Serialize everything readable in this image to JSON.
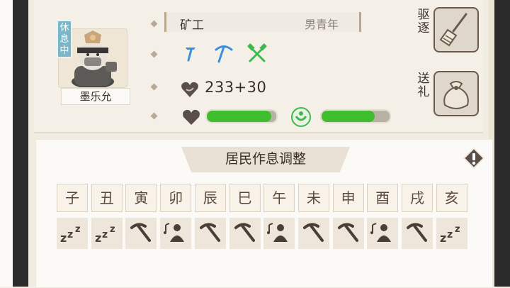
{
  "resident": {
    "name": "墨乐允",
    "status_badge": "休息中",
    "profession": "矿工",
    "age_group": "男青年",
    "skills": [
      "pickaxe-icon",
      "pick-blue-icon",
      "crossed-hammers-icon"
    ],
    "value_text": "233+30",
    "health_level": 0.93,
    "mood_level": 0.78
  },
  "actions": {
    "expel_label": "驱逐",
    "gift_label": "送礼"
  },
  "schedule": {
    "title": "居民作息调整",
    "hours": [
      "子",
      "丑",
      "寅",
      "卯",
      "辰",
      "巳",
      "午",
      "未",
      "申",
      "酉",
      "戌",
      "亥"
    ],
    "activities": [
      "sleep",
      "sleep",
      "mine",
      "leisure",
      "mine",
      "mine",
      "leisure",
      "mine",
      "mine",
      "leisure",
      "mine",
      "sleep"
    ]
  },
  "colors": {
    "bar_fill": "#3ebd2d",
    "bar_track": "#b9b1a4",
    "badge": "#7ab6c7",
    "icon_blue": "#3a8fe0",
    "icon_green": "#3fb84d"
  }
}
